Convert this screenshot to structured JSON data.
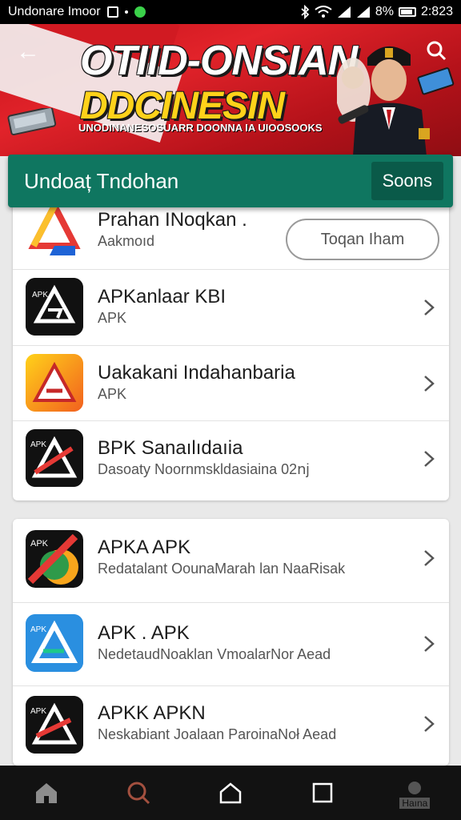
{
  "status_bar": {
    "carrier": "Undonare Imoor",
    "battery": "8%",
    "time": "2:823"
  },
  "banner": {
    "title": "OTIID-ONSIAN",
    "subtitle": "DDCINESIN",
    "tagline": "UNODINANESOSUARR DOONNA IA UIOOSOOKS"
  },
  "header": {
    "title": "Undoaț Tndohan",
    "action_label": "Soons"
  },
  "list_top": [
    {
      "name": "Prahan INoqkan .",
      "desc": "Aakmoıd",
      "button": "Toqan Iham",
      "icon": "triangle-app-icon"
    },
    {
      "name": "APKanlaar KBI",
      "desc": "APK",
      "icon": "black-triangle-app-icon"
    },
    {
      "name": "Uakakani Indahanbaria",
      "desc": "APK",
      "icon": "yellow-triangle-app-icon"
    },
    {
      "name": "BPK Sanaılıdaıia",
      "desc": "Dasoaty Noornmskldasiaina 02ոj",
      "icon": "red-triangle-app-icon"
    }
  ],
  "list_bottom": [
    {
      "name": "APKA APK",
      "desc": "Redatalant OounaMarah lan NaaRisak",
      "icon": "green-red-app-icon"
    },
    {
      "name": "APK . APK",
      "desc": "NedetaudNoaklan VmoalarNor Aead",
      "icon": "blue-triangle-app-icon"
    },
    {
      "name": "APKK APKN",
      "desc": "Neskabiant Joalaan ParoinaNoł Aead",
      "icon": "black-red-app-icon"
    }
  ],
  "nav": {
    "profile_label": "Haına"
  },
  "colors": {
    "banner_red": "#d11a22",
    "header_green": "#0f7660",
    "title_yellow": "#ffd21a"
  }
}
